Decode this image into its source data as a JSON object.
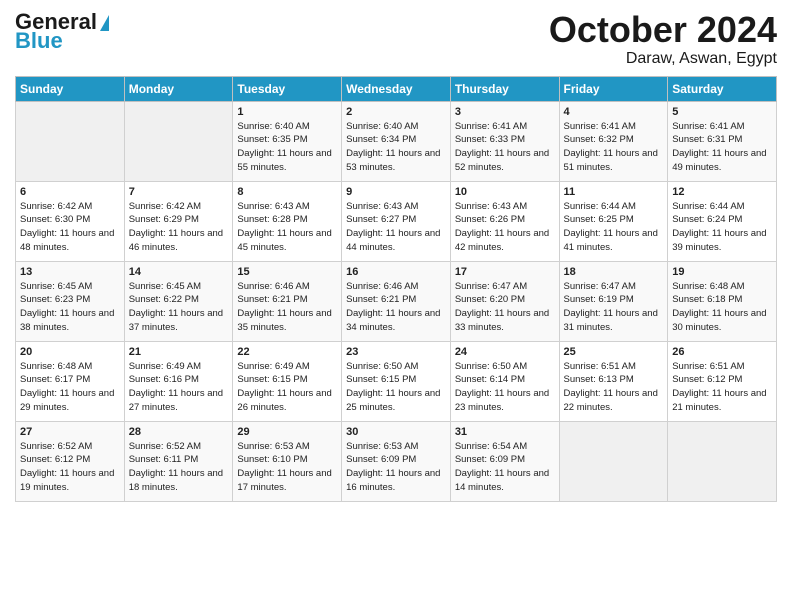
{
  "header": {
    "logo_line1": "General",
    "logo_line2": "Blue",
    "title": "October 2024",
    "subtitle": "Daraw, Aswan, Egypt"
  },
  "columns": [
    "Sunday",
    "Monday",
    "Tuesday",
    "Wednesday",
    "Thursday",
    "Friday",
    "Saturday"
  ],
  "weeks": [
    [
      {
        "num": "",
        "info": "",
        "empty": true
      },
      {
        "num": "",
        "info": "",
        "empty": true
      },
      {
        "num": "1",
        "info": "Sunrise: 6:40 AM\nSunset: 6:35 PM\nDaylight: 11 hours and 55 minutes."
      },
      {
        "num": "2",
        "info": "Sunrise: 6:40 AM\nSunset: 6:34 PM\nDaylight: 11 hours and 53 minutes."
      },
      {
        "num": "3",
        "info": "Sunrise: 6:41 AM\nSunset: 6:33 PM\nDaylight: 11 hours and 52 minutes."
      },
      {
        "num": "4",
        "info": "Sunrise: 6:41 AM\nSunset: 6:32 PM\nDaylight: 11 hours and 51 minutes."
      },
      {
        "num": "5",
        "info": "Sunrise: 6:41 AM\nSunset: 6:31 PM\nDaylight: 11 hours and 49 minutes."
      }
    ],
    [
      {
        "num": "6",
        "info": "Sunrise: 6:42 AM\nSunset: 6:30 PM\nDaylight: 11 hours and 48 minutes."
      },
      {
        "num": "7",
        "info": "Sunrise: 6:42 AM\nSunset: 6:29 PM\nDaylight: 11 hours and 46 minutes."
      },
      {
        "num": "8",
        "info": "Sunrise: 6:43 AM\nSunset: 6:28 PM\nDaylight: 11 hours and 45 minutes."
      },
      {
        "num": "9",
        "info": "Sunrise: 6:43 AM\nSunset: 6:27 PM\nDaylight: 11 hours and 44 minutes."
      },
      {
        "num": "10",
        "info": "Sunrise: 6:43 AM\nSunset: 6:26 PM\nDaylight: 11 hours and 42 minutes."
      },
      {
        "num": "11",
        "info": "Sunrise: 6:44 AM\nSunset: 6:25 PM\nDaylight: 11 hours and 41 minutes."
      },
      {
        "num": "12",
        "info": "Sunrise: 6:44 AM\nSunset: 6:24 PM\nDaylight: 11 hours and 39 minutes."
      }
    ],
    [
      {
        "num": "13",
        "info": "Sunrise: 6:45 AM\nSunset: 6:23 PM\nDaylight: 11 hours and 38 minutes."
      },
      {
        "num": "14",
        "info": "Sunrise: 6:45 AM\nSunset: 6:22 PM\nDaylight: 11 hours and 37 minutes."
      },
      {
        "num": "15",
        "info": "Sunrise: 6:46 AM\nSunset: 6:21 PM\nDaylight: 11 hours and 35 minutes."
      },
      {
        "num": "16",
        "info": "Sunrise: 6:46 AM\nSunset: 6:21 PM\nDaylight: 11 hours and 34 minutes."
      },
      {
        "num": "17",
        "info": "Sunrise: 6:47 AM\nSunset: 6:20 PM\nDaylight: 11 hours and 33 minutes."
      },
      {
        "num": "18",
        "info": "Sunrise: 6:47 AM\nSunset: 6:19 PM\nDaylight: 11 hours and 31 minutes."
      },
      {
        "num": "19",
        "info": "Sunrise: 6:48 AM\nSunset: 6:18 PM\nDaylight: 11 hours and 30 minutes."
      }
    ],
    [
      {
        "num": "20",
        "info": "Sunrise: 6:48 AM\nSunset: 6:17 PM\nDaylight: 11 hours and 29 minutes."
      },
      {
        "num": "21",
        "info": "Sunrise: 6:49 AM\nSunset: 6:16 PM\nDaylight: 11 hours and 27 minutes."
      },
      {
        "num": "22",
        "info": "Sunrise: 6:49 AM\nSunset: 6:15 PM\nDaylight: 11 hours and 26 minutes."
      },
      {
        "num": "23",
        "info": "Sunrise: 6:50 AM\nSunset: 6:15 PM\nDaylight: 11 hours and 25 minutes."
      },
      {
        "num": "24",
        "info": "Sunrise: 6:50 AM\nSunset: 6:14 PM\nDaylight: 11 hours and 23 minutes."
      },
      {
        "num": "25",
        "info": "Sunrise: 6:51 AM\nSunset: 6:13 PM\nDaylight: 11 hours and 22 minutes."
      },
      {
        "num": "26",
        "info": "Sunrise: 6:51 AM\nSunset: 6:12 PM\nDaylight: 11 hours and 21 minutes."
      }
    ],
    [
      {
        "num": "27",
        "info": "Sunrise: 6:52 AM\nSunset: 6:12 PM\nDaylight: 11 hours and 19 minutes."
      },
      {
        "num": "28",
        "info": "Sunrise: 6:52 AM\nSunset: 6:11 PM\nDaylight: 11 hours and 18 minutes."
      },
      {
        "num": "29",
        "info": "Sunrise: 6:53 AM\nSunset: 6:10 PM\nDaylight: 11 hours and 17 minutes."
      },
      {
        "num": "30",
        "info": "Sunrise: 6:53 AM\nSunset: 6:09 PM\nDaylight: 11 hours and 16 minutes."
      },
      {
        "num": "31",
        "info": "Sunrise: 6:54 AM\nSunset: 6:09 PM\nDaylight: 11 hours and 14 minutes."
      },
      {
        "num": "",
        "info": "",
        "empty": true
      },
      {
        "num": "",
        "info": "",
        "empty": true
      }
    ]
  ]
}
